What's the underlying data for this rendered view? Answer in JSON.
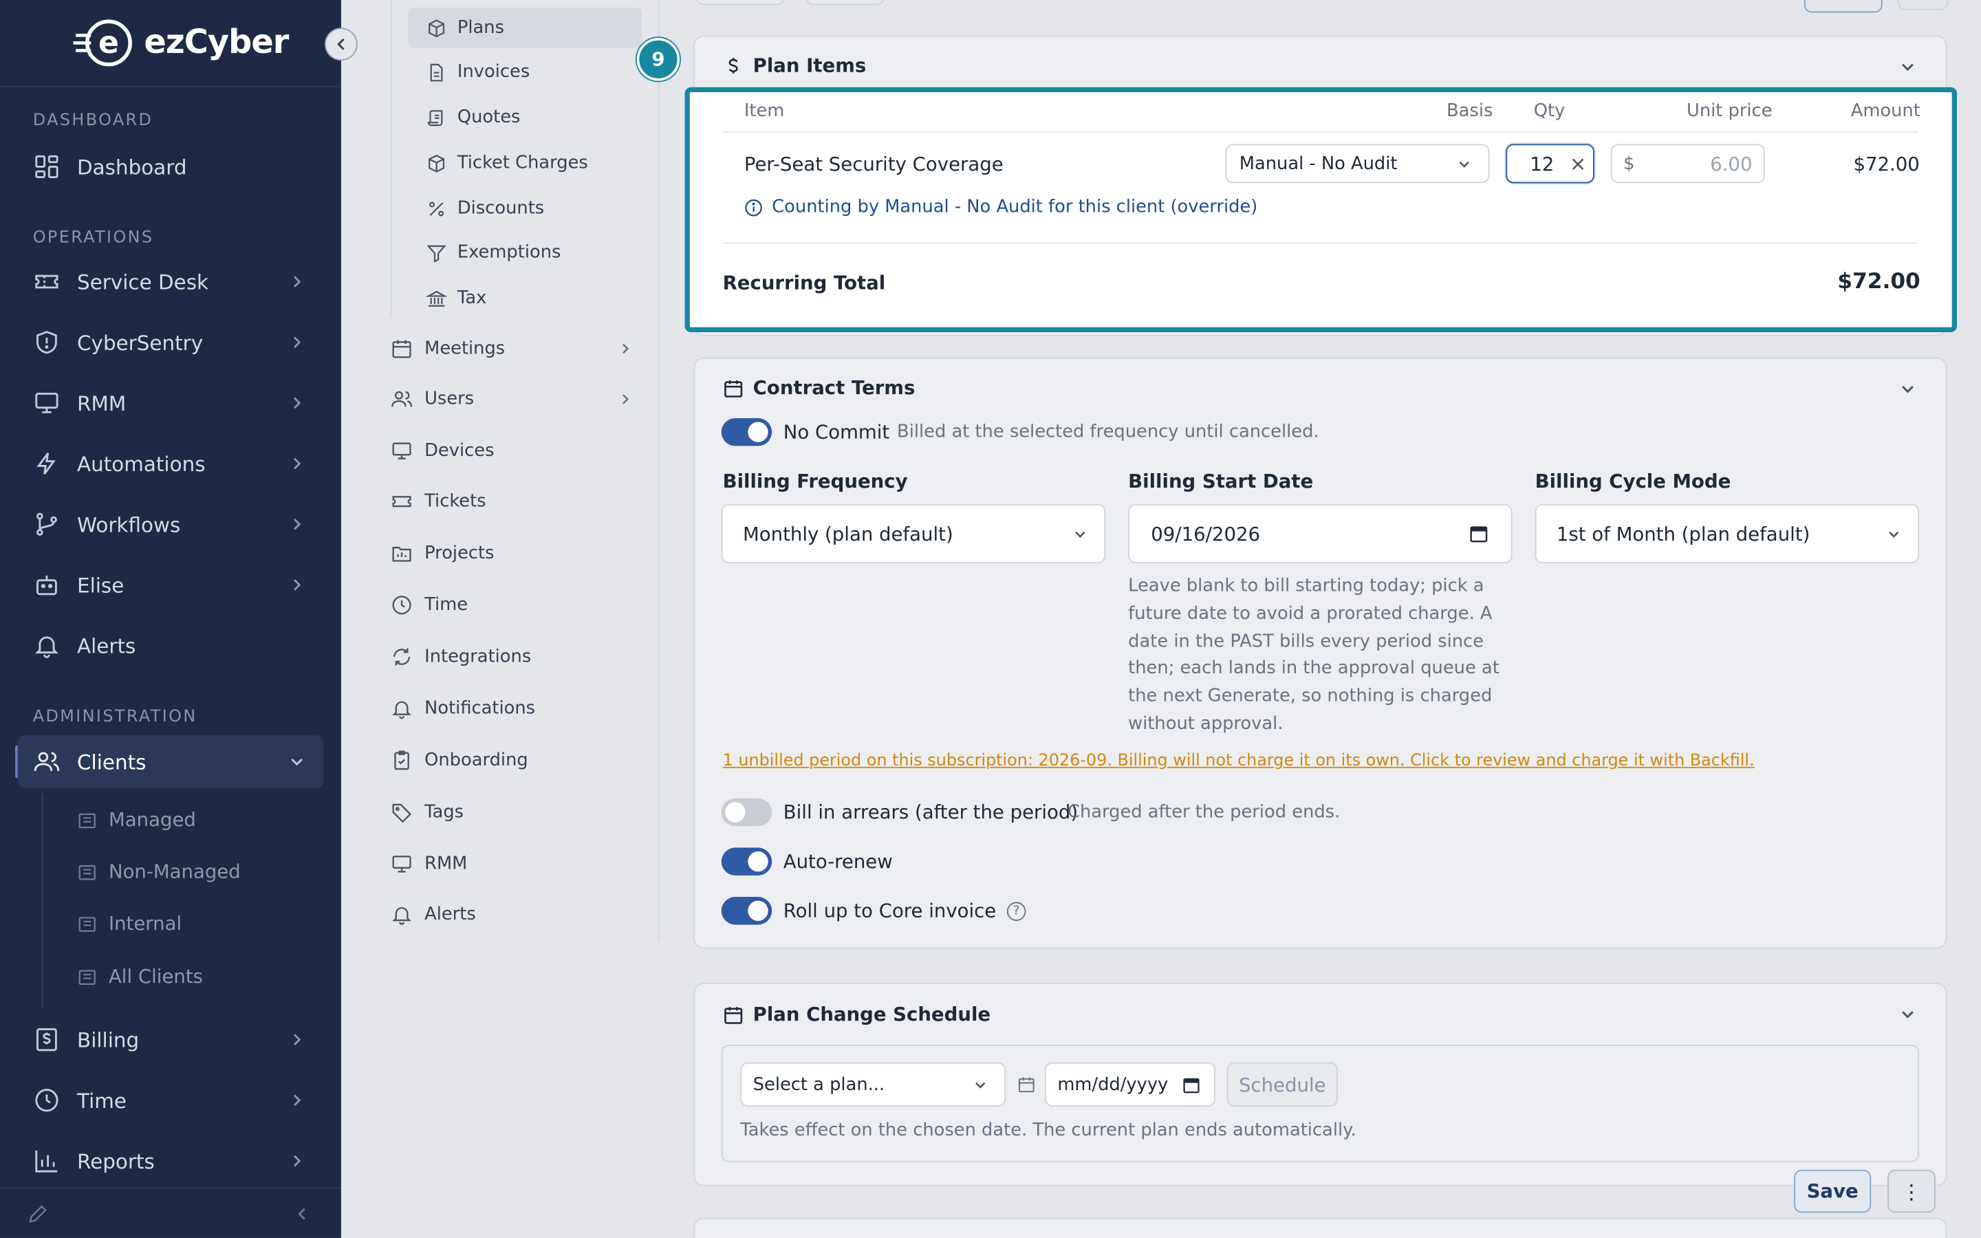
{
  "brand": {
    "name": "ezCyber",
    "letter": "e"
  },
  "sidebar": {
    "sections": [
      "DASHBOARD",
      "OPERATIONS",
      "ADMINISTRATION"
    ],
    "items": [
      {
        "label": "Dashboard",
        "icon": "grid-icon"
      },
      {
        "label": "Service Desk",
        "icon": "ticket-icon"
      },
      {
        "label": "CyberSentry",
        "icon": "shield-icon"
      },
      {
        "label": "RMM",
        "icon": "monitor-icon"
      },
      {
        "label": "Automations",
        "icon": "lightning-icon"
      },
      {
        "label": "Workflows",
        "icon": "branch-icon"
      },
      {
        "label": "Elise",
        "icon": "robot-icon"
      },
      {
        "label": "Alerts",
        "icon": "bell-icon"
      },
      {
        "label": "Clients",
        "icon": "users-icon"
      },
      {
        "label": "Billing",
        "icon": "dollar-file-icon"
      },
      {
        "label": "Time",
        "icon": "clock-icon"
      },
      {
        "label": "Reports",
        "icon": "bar-chart-icon"
      }
    ],
    "client_sub": [
      "Managed",
      "Non-Managed",
      "Internal",
      "All Clients"
    ]
  },
  "secnav": {
    "billing_sub": [
      "Plans",
      "Invoices",
      "Quotes",
      "Ticket Charges",
      "Discounts",
      "Exemptions",
      "Tax"
    ],
    "items": [
      "Meetings",
      "Users",
      "Devices",
      "Tickets",
      "Projects",
      "Time",
      "Integrations",
      "Notifications",
      "Onboarding",
      "Tags",
      "RMM",
      "Alerts"
    ]
  },
  "plan_items": {
    "badge": "9",
    "title": "Plan Items",
    "headers": {
      "item": "Item",
      "basis": "Basis",
      "qty": "Qty",
      "unit_price": "Unit price",
      "amount": "Amount"
    },
    "row": {
      "item": "Per-Seat Security Coverage",
      "basis": "Manual - No Audit",
      "qty": "12",
      "currency": "$",
      "unit_price": "6.00",
      "amount": "$72.00",
      "note": "Counting by Manual - No Audit for this client (override)"
    },
    "total_label": "Recurring Total",
    "total_value": "$72.00"
  },
  "contract": {
    "title": "Contract Terms",
    "no_commit": {
      "label": "No Commit",
      "hint": "Billed at the selected frequency until cancelled.",
      "on": true
    },
    "billing_frequency": {
      "label": "Billing Frequency",
      "value": "Monthly (plan default)"
    },
    "billing_start": {
      "label": "Billing Start Date",
      "value": "09/16/2026"
    },
    "billing_cycle": {
      "label": "Billing Cycle Mode",
      "value": "1st of Month (plan default)"
    },
    "start_help": [
      "Leave blank to bill starting today; pick a",
      "future date to avoid a prorated charge. A",
      "date in the PAST bills every period since",
      "then; each lands in the approval queue at",
      "the next Generate, so nothing is charged",
      "without approval."
    ],
    "unbilled_link": "1 unbilled period on this subscription: 2026-09. Billing will not charge it on its own. Click to review and charge it with Backfill.",
    "arrears": {
      "label": "Bill in arrears (after the period)",
      "hint": "Charged after the period ends.",
      "on": false
    },
    "auto_renew": {
      "label": "Auto-renew",
      "on": true
    },
    "roll_up": {
      "label": "Roll up to Core invoice",
      "on": true
    },
    "help_glyph": "?"
  },
  "schedule": {
    "title": "Plan Change Schedule",
    "select_placeholder": "Select a plan...",
    "date_placeholder": "mm/dd/yyyy",
    "schedule_button": "Schedule",
    "hint": "Takes effect on the chosen date. The current plan ends automatically."
  },
  "footer": {
    "save": "Save",
    "more": "⋮"
  },
  "colors": {
    "sidebar": "#1e2a45",
    "accent": "#17889f",
    "toggle_on": "#2f5aa6",
    "warning_link": "#d4870f"
  }
}
